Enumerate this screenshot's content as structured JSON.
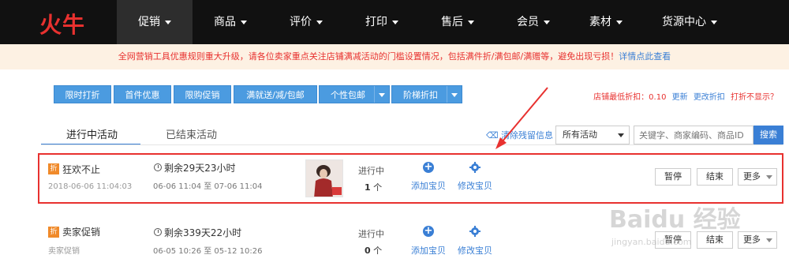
{
  "header": {
    "logo": "火牛",
    "nav": [
      {
        "label": "促销",
        "active": true
      },
      {
        "label": "商品"
      },
      {
        "label": "评价"
      },
      {
        "label": "打印"
      },
      {
        "label": "售后"
      },
      {
        "label": "会员"
      },
      {
        "label": "素材"
      },
      {
        "label": "货源中心"
      }
    ]
  },
  "notice": {
    "text": "全网营销工具优惠规则重大升级，请各位卖家重点关注店铺满减活动的门槛设置情况，包括满件折/满包邮/满赠等，避免出现亏损！",
    "link": "详情点此查看"
  },
  "toolbar": {
    "buttons": [
      "限时打折",
      "首件优惠",
      "限购促销",
      "满就送/减/包邮",
      "个性包邮",
      "阶梯折扣"
    ]
  },
  "shop_info": {
    "min_discount": "店铺最低折扣：0.10",
    "update": "更新",
    "change_discount": "更改折扣",
    "not_showing": "打折不显示？"
  },
  "tabs": {
    "active": "进行中活动",
    "ended": "已结束活动"
  },
  "filters": {
    "clear_link": "清除残留信息",
    "select_value": "所有活动",
    "search_placeholder": "关键字、商家编码、商品ID",
    "search_button": "搜索"
  },
  "activities": [
    {
      "badge": "折",
      "title": "狂欢不止",
      "date": "2018-06-06 11:04:03",
      "remaining": "剩余29天23小时",
      "period": "06-06 11:04 至 07-06 11:04",
      "status": "进行中",
      "count": "1",
      "count_unit": "个",
      "add_label": "添加宝贝",
      "edit_label": "修改宝贝",
      "pause": "暂停",
      "end": "结束",
      "more": "更多",
      "has_thumb": true
    },
    {
      "badge": "折",
      "title": "卖家促销",
      "date": "卖家促销",
      "remaining": "剩余339天22小时",
      "period": "06-05 10:26 至 05-12 10:26",
      "status": "进行中",
      "count": "0",
      "count_unit": "个",
      "add_label": "添加宝贝",
      "edit_label": "修改宝贝",
      "pause": "暂停",
      "end": "结束",
      "more": "更多",
      "has_thumb": false
    }
  ],
  "watermark": {
    "main": "Baidu 经验",
    "sub": "jingyan.baidu.com"
  },
  "colors": {
    "accent_blue": "#4b9be0",
    "link_blue": "#3a7fd5",
    "alert_red": "#e8312f",
    "nav_bg": "#111111",
    "notice_bg": "#fdf1e3"
  }
}
